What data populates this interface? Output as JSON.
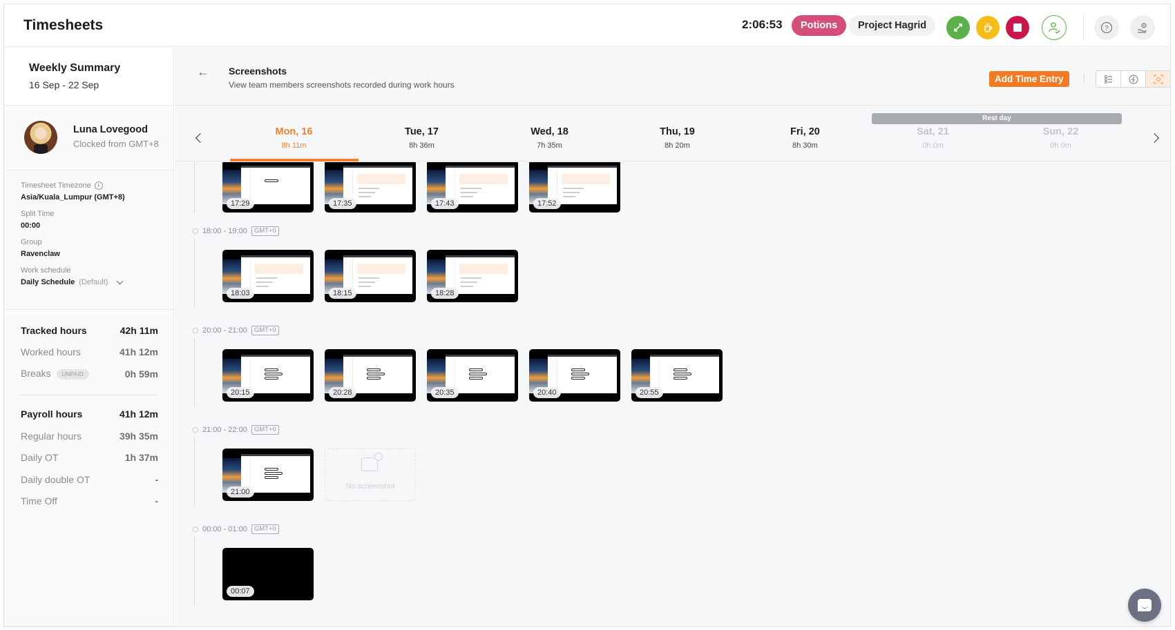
{
  "app": {
    "title": "Timesheets"
  },
  "topbar": {
    "timer": "2:06:53",
    "activity_pill": "Potions",
    "project_pill": "Project Hagrid",
    "icons": [
      "switch-task-icon",
      "coffee-break-icon",
      "stop-icon",
      "user-check-icon",
      "help-icon",
      "settings-icon"
    ]
  },
  "sidebar": {
    "weekly_summary_title": "Weekly Summary",
    "date_range": "16 Sep - 22 Sep",
    "user": {
      "name": "Luna Lovegood",
      "clocked_from": "Clocked from GMT+8"
    },
    "meta": {
      "timezone_label": "Timesheet Timezone",
      "timezone_value": "Asia/Kuala_Lumpur (GMT+8)",
      "split_label": "Split Time",
      "split_value": "00:00",
      "group_label": "Group",
      "group_value": "Ravenclaw",
      "schedule_label": "Work schedule",
      "schedule_value": "Daily Schedule",
      "schedule_suffix": "(Default)"
    },
    "tracked": [
      {
        "label": "Tracked hours",
        "value": "42h 11m"
      },
      {
        "label": "Worked hours",
        "value": "41h 12m"
      },
      {
        "label": "Breaks",
        "badge": "UNPAID",
        "value": "0h 59m"
      }
    ],
    "payroll": [
      {
        "label": "Payroll hours",
        "value": "41h 12m"
      },
      {
        "label": "Regular hours",
        "value": "39h 35m"
      },
      {
        "label": "Daily OT",
        "value": "1h 37m"
      },
      {
        "label": "Daily double OT",
        "value": "-"
      },
      {
        "label": "Time Off",
        "value": "-"
      }
    ]
  },
  "section": {
    "title": "Screenshots",
    "subtitle": "View team members screenshots recorded during work hours",
    "add_button": "Add Time Entry"
  },
  "days": {
    "rest_label": "Rest day",
    "items": [
      {
        "name": "Mon, 16",
        "hours": "8h 11m",
        "state": "active"
      },
      {
        "name": "Tue, 17",
        "hours": "8h 36m",
        "state": "normal"
      },
      {
        "name": "Wed, 18",
        "hours": "7h 35m",
        "state": "normal"
      },
      {
        "name": "Thu, 19",
        "hours": "8h 20m",
        "state": "normal"
      },
      {
        "name": "Fri, 20",
        "hours": "8h 30m",
        "state": "normal"
      },
      {
        "name": "Sat, 21",
        "hours": "0h 0m",
        "state": "rest"
      },
      {
        "name": "Sun, 22",
        "hours": "0h 0m",
        "state": "rest"
      }
    ]
  },
  "slots": [
    {
      "range": "",
      "tz": "",
      "shots": [
        {
          "time": "17:29",
          "style": "bars"
        },
        {
          "time": "17:35",
          "style": "highlight"
        },
        {
          "time": "17:43",
          "style": "highlight"
        },
        {
          "time": "17:52",
          "style": "highlight"
        }
      ]
    },
    {
      "range": "18:00 - 19:00",
      "tz": "GMT+0",
      "shots": [
        {
          "time": "18:03",
          "style": "highlight"
        },
        {
          "time": "18:15",
          "style": "highlight"
        },
        {
          "time": "18:28",
          "style": "highlight"
        }
      ]
    },
    {
      "range": "20:00 - 21:00",
      "tz": "GMT+0",
      "shots": [
        {
          "time": "20:15",
          "style": "bars"
        },
        {
          "time": "20:28",
          "style": "bars"
        },
        {
          "time": "20:35",
          "style": "bars"
        },
        {
          "time": "20:40",
          "style": "bars"
        },
        {
          "time": "20:55",
          "style": "bars"
        }
      ]
    },
    {
      "range": "21:00 - 22:00",
      "tz": "GMT+0",
      "shots": [
        {
          "time": "21:00",
          "style": "bars"
        },
        {
          "time": null,
          "style": "empty",
          "empty_label": "No screenshot"
        }
      ]
    },
    {
      "range": "00:00 - 01:00",
      "tz": "GMT+0",
      "shots": [
        {
          "time": "00:07",
          "style": "blank"
        }
      ]
    }
  ]
}
